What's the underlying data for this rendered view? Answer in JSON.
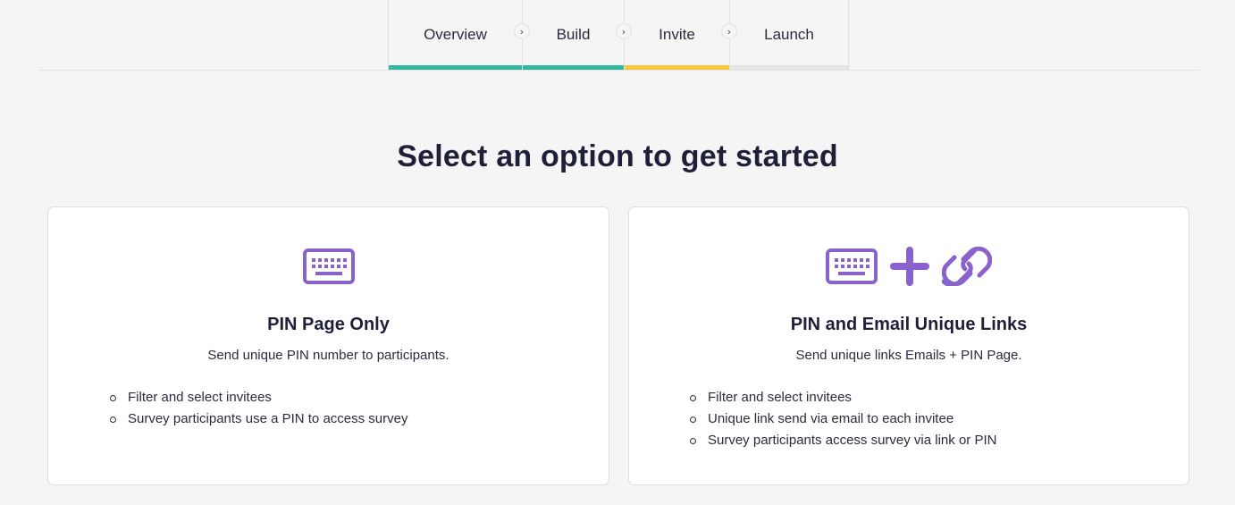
{
  "stepper": {
    "steps": [
      {
        "label": "Overview",
        "state": "done"
      },
      {
        "label": "Build",
        "state": "done"
      },
      {
        "label": "Invite",
        "state": "current"
      },
      {
        "label": "Launch",
        "state": "upcoming"
      }
    ],
    "colors": {
      "done": "#34b7a2",
      "current": "#f7c63a",
      "upcoming": "#e6e6e6"
    }
  },
  "heading": "Select an option to get started",
  "accent_color": "#8a62cc",
  "options": [
    {
      "icons": [
        "keyboard-icon"
      ],
      "title": "PIN Page Only",
      "description": "Send unique PIN number to participants.",
      "bullets": [
        "Filter and select invitees",
        "Survey participants use a PIN to access survey"
      ]
    },
    {
      "icons": [
        "keyboard-icon",
        "plus-icon",
        "link-icon"
      ],
      "title": "PIN and Email Unique Links",
      "description": "Send unique links Emails + PIN Page.",
      "bullets": [
        "Filter and select invitees",
        "Unique link send via email to each invitee",
        "Survey participants access survey via link or PIN"
      ]
    }
  ]
}
